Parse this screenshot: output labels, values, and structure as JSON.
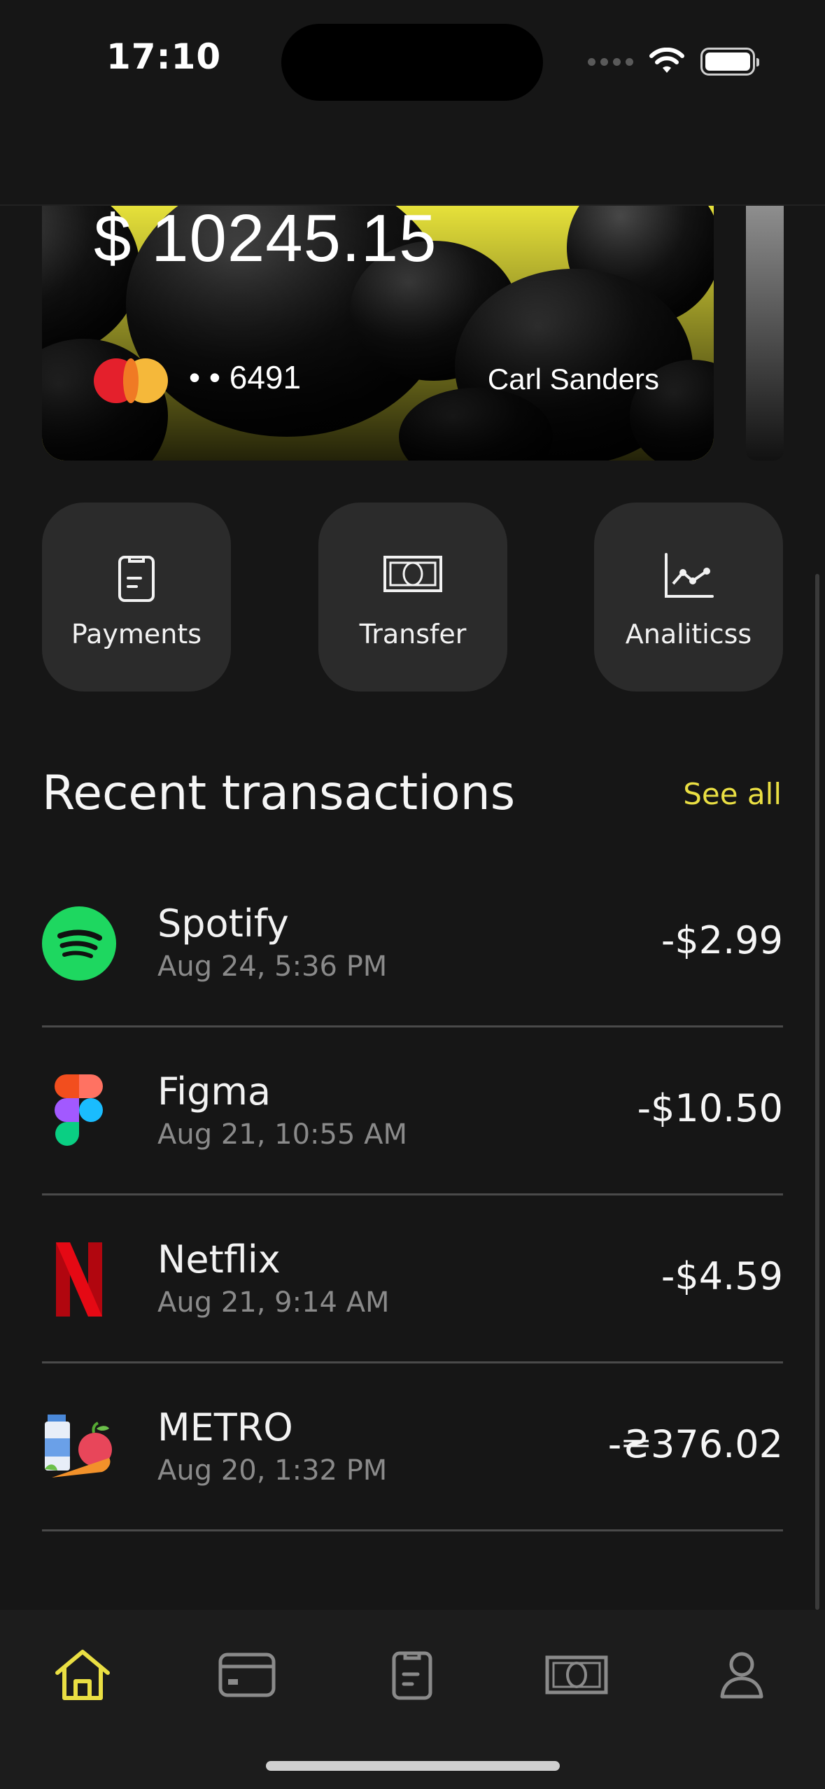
{
  "status_bar": {
    "time": "17:10"
  },
  "card": {
    "balance": "$ 10245.15",
    "number_masked": "• • 6491",
    "holder": "Carl Sanders",
    "brand_icon": "mastercard-icon"
  },
  "actions": [
    {
      "label": "Payments",
      "icon": "receipt-icon"
    },
    {
      "label": "Transfer",
      "icon": "banknote-icon"
    },
    {
      "label": "Analiticss",
      "icon": "line-chart-icon"
    }
  ],
  "transactions_section": {
    "title": "Recent transactions",
    "see_all": "See all"
  },
  "transactions": [
    {
      "name": "Spotify",
      "date": "Aug 24, 5:36 PM",
      "amount": "-$2.99",
      "icon": "spotify-icon"
    },
    {
      "name": "Figma",
      "date": "Aug 21, 10:55 AM",
      "amount": "-$10.50",
      "icon": "figma-icon"
    },
    {
      "name": "Netflix",
      "date": "Aug 21, 9:14 AM",
      "amount": "-$4.59",
      "icon": "netflix-icon"
    },
    {
      "name": "METRO",
      "date": "Aug 20, 1:32 PM",
      "amount": "-₴376.02",
      "icon": "groceries-icon"
    }
  ],
  "tabbar": {
    "items": [
      {
        "icon": "home-icon",
        "active": true
      },
      {
        "icon": "card-icon",
        "active": false
      },
      {
        "icon": "receipt-icon",
        "active": false
      },
      {
        "icon": "banknote-icon",
        "active": false
      },
      {
        "icon": "profile-icon",
        "active": false
      }
    ]
  },
  "colors": {
    "background": "#161616",
    "surface": "#2b2b2b",
    "accent": "#eadf43",
    "text_secondary": "#8a8a8a"
  }
}
